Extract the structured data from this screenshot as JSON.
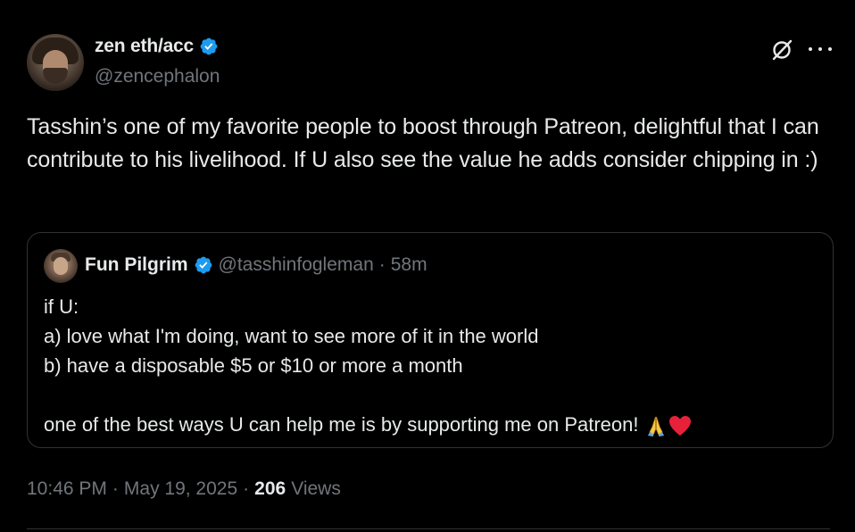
{
  "author": {
    "display_name": "zen eth/acc",
    "handle": "@zencephalon",
    "verified": true,
    "avatar_icon": "avatar"
  },
  "tweet": {
    "text": "Tasshin’s one of my favorite people to boost through Patreon, delightful that I can contribute to his livelihood. If U also see the value he adds consider chipping in :)"
  },
  "quoted": {
    "display_name": "Fun Pilgrim",
    "handle": "@tasshinfogleman",
    "separator": "·",
    "time": "58m",
    "verified": true,
    "lines": [
      "if U:",
      "a) love what I'm doing, want to see more of it in the world",
      "b) have a disposable $5 or $10 or more a month",
      "",
      "one of the best ways U can help me is by supporting me on Patreon!"
    ],
    "trailing_emoji": [
      "folded-hands-emoji",
      "red-heart-emoji"
    ]
  },
  "meta": {
    "time": "10:46 PM",
    "separator": "·",
    "date": "May 19, 2025",
    "separator2": "·",
    "views_count": "206",
    "views_label": "Views"
  },
  "colors": {
    "background": "#000000",
    "text": "#e7e9ea",
    "muted": "#71767b",
    "verified": "#1d9bf0",
    "border": "#2f3336"
  },
  "icons": {
    "top_right": [
      "grok-icon",
      "more-icon"
    ]
  }
}
